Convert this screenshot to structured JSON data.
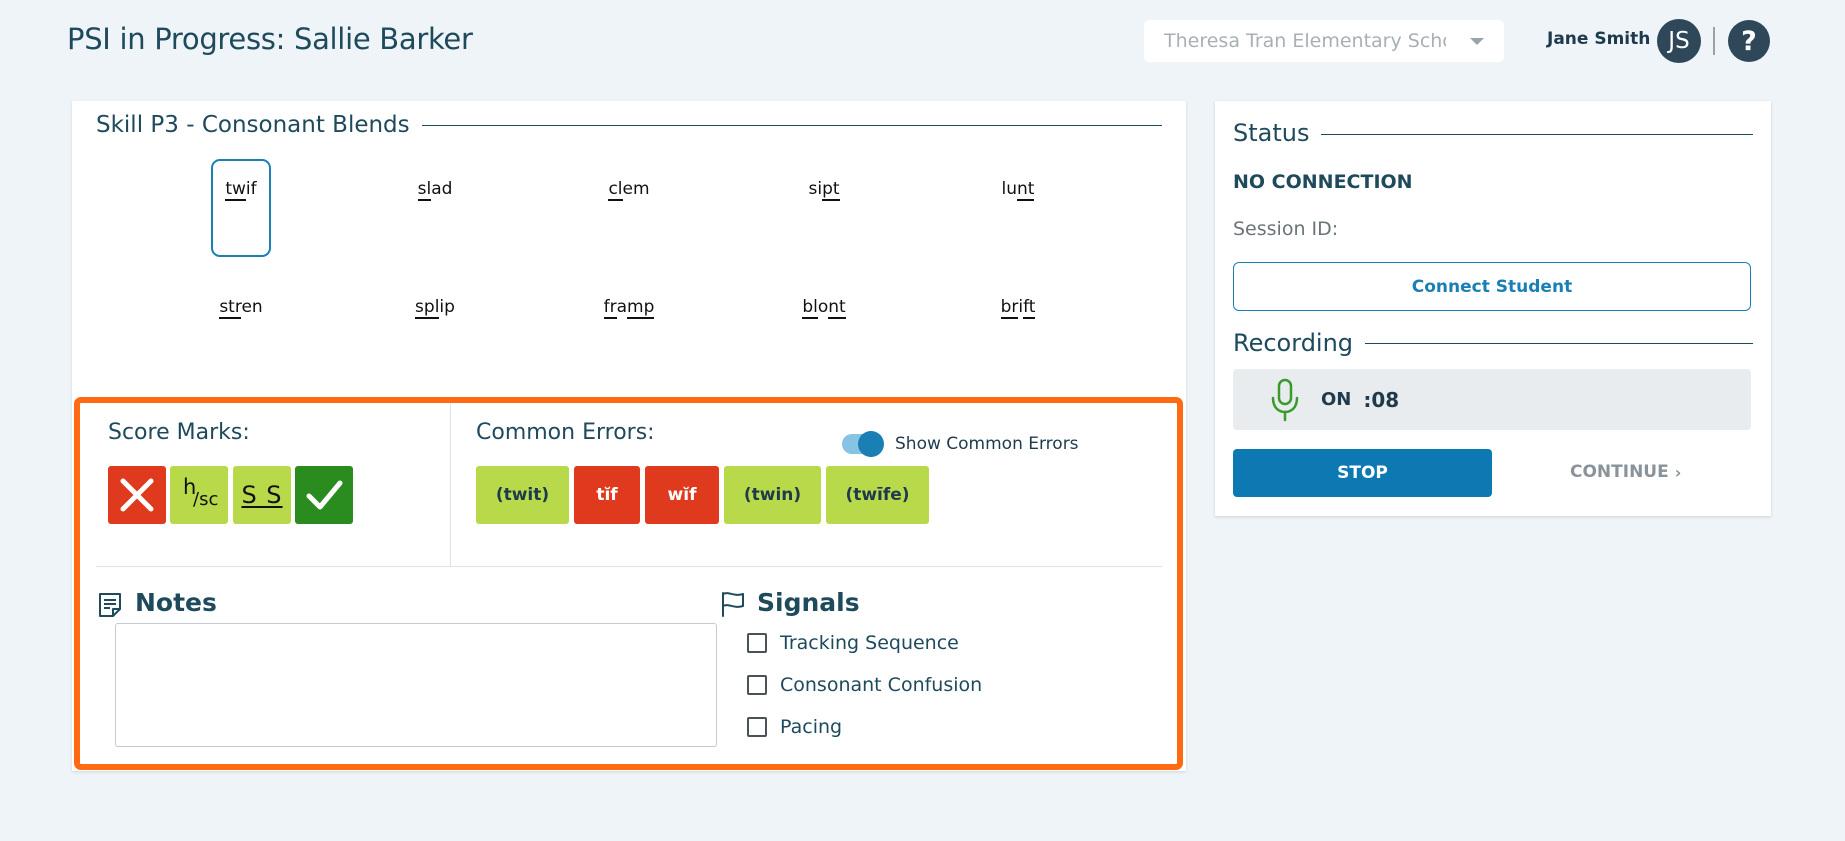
{
  "header": {
    "title": "PSI in Progress: Sallie Barker",
    "school_select": "Theresa Tran Elementary School",
    "user_name": "Jane Smith",
    "avatar_initials": "JS",
    "help_label": "?"
  },
  "skill": {
    "title": "Skill P3 - Consonant Blends",
    "words": [
      {
        "pre": "",
        "u": "tw",
        "post": "if"
      },
      {
        "pre": "",
        "u": "sl",
        "post": "ad"
      },
      {
        "pre": "",
        "u": "cl",
        "post": "em"
      },
      {
        "pre": "si",
        "u": "pt",
        "post": ""
      },
      {
        "pre": "lu",
        "u": "nt",
        "post": ""
      },
      {
        "pre": "",
        "u": "str",
        "post": "en"
      },
      {
        "pre": "",
        "u": "spl",
        "post": "ip"
      },
      {
        "pre": "",
        "u": "fr",
        "post": "a",
        "u2": "mp"
      },
      {
        "pre": "",
        "u": "bl",
        "post": "o",
        "u2": "nt"
      },
      {
        "pre": "",
        "u": "br",
        "post": "i",
        "u2": "ft"
      }
    ]
  },
  "score_marks": {
    "label": "Score Marks:",
    "hsc_h": "h",
    "hsc_sc": "/sc",
    "ss_label": "S S"
  },
  "common_errors": {
    "label": "Common Errors:",
    "toggle_label": "Show Common Errors",
    "toggle_on": true,
    "items": [
      "(twit)",
      "tĭf",
      "wĭf",
      "(twin)",
      "(twīfe)"
    ]
  },
  "notes": {
    "label": "Notes",
    "value": ""
  },
  "signals": {
    "label": "Signals",
    "items": [
      "Tracking Sequence",
      "Consonant Confusion",
      "Pacing"
    ]
  },
  "status": {
    "title": "Status",
    "connection": "NO CONNECTION",
    "session_label": "Session ID:",
    "connect_button": "Connect Student",
    "recording_title": "Recording",
    "recording_state": "ON",
    "recording_time": ":08",
    "stop_button": "STOP",
    "continue_button": "CONTINUE"
  },
  "colors": {
    "primary": "#0c79b2",
    "highlight": "#ff6a13",
    "error_red": "#e03a1e",
    "soft_green": "#b8d94a",
    "dark_green": "#2a8c1e",
    "mic_green": "#3a9a2a"
  }
}
